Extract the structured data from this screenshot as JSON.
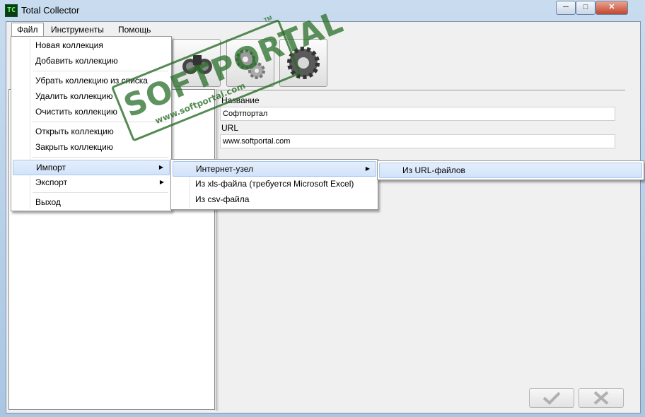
{
  "window": {
    "title": "Total Collector",
    "icon_glyph": "TC",
    "minimize": "─",
    "maximize": "□",
    "close": "✕"
  },
  "menubar": {
    "items": [
      {
        "label": "Файл"
      },
      {
        "label": "Инструменты"
      },
      {
        "label": "Помощь"
      }
    ]
  },
  "file_menu": {
    "items": [
      {
        "label": "Новая коллекция"
      },
      {
        "label": "Добавить коллекцию"
      },
      {
        "label": "Убрать коллекцию из списка"
      },
      {
        "label": "Удалить коллекцию"
      },
      {
        "label": "Очистить коллекцию"
      },
      {
        "label": "Открыть коллекцию"
      },
      {
        "label": "Закрыть коллекцию"
      },
      {
        "label": "Импорт",
        "arrow": "▶"
      },
      {
        "label": "Экспорт",
        "arrow": "▶"
      },
      {
        "label": "Выход"
      }
    ]
  },
  "import_menu": {
    "items": [
      {
        "label": "Интернет-узел",
        "arrow": "▶"
      },
      {
        "label": "Из xls-файла (требуется Microsoft Excel)"
      },
      {
        "label": "Из csv-файла"
      }
    ]
  },
  "internet_menu": {
    "items": [
      {
        "label": "Из URL-файлов"
      }
    ]
  },
  "form": {
    "name_label": "Название",
    "name_value": "Софтпортал",
    "url_label": "URL",
    "url_value": "www.softportal.com"
  },
  "toolbar": {
    "icons": [
      "binoculars-icon",
      "gears-icon",
      "gear-icon"
    ]
  },
  "buttons": {
    "ok_icon": "checkmark-icon",
    "cancel_icon": "cross-icon",
    "ok_glyph": "✔",
    "cancel_glyph": "✖"
  },
  "watermark": {
    "text": "SOFTPORTAL",
    "url": "www.softportal.com",
    "tm": "TM"
  },
  "colors": {
    "highlight": "#d1e3fb",
    "watermark": "#286e28"
  }
}
